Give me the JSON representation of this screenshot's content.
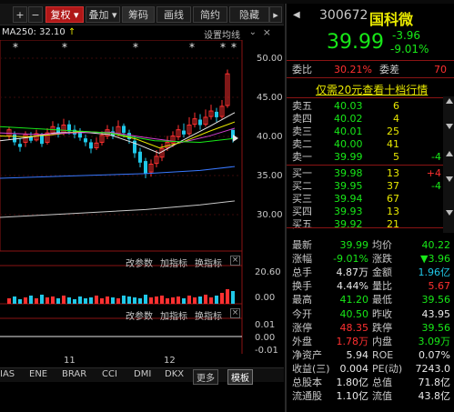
{
  "toolbar": {
    "plus_label": "+",
    "minus_label": "−",
    "rights_label": "复权",
    "overlay_label": "叠加",
    "chips_label": "筹码",
    "draw_label": "画线",
    "brief_label": "简约",
    "hide_label": "隐藏",
    "more_label": "▸"
  },
  "ma_bar": {
    "text": "MA250: 32.10",
    "settings": "设置均线"
  },
  "price_axis": [
    "50.00",
    "45.00",
    "40.00",
    "35.00",
    "30.00"
  ],
  "indicator1": {
    "params_label": "改参数",
    "add_label": "加指标",
    "switch_label": "换指标",
    "close_label": "×",
    "axis": [
      "20.60",
      "0.00"
    ]
  },
  "indicator2": {
    "params_label": "改参数",
    "add_label": "加指标",
    "switch_label": "换指标",
    "close_label": "×",
    "axis": [
      "0.01",
      "0.00",
      "-0.01"
    ]
  },
  "date_axis": [
    "11",
    "12"
  ],
  "bottom_tabs": [
    "IAS",
    "ENE",
    "BRAR",
    "CCI",
    "DMI",
    "DKX",
    "更多",
    "模板"
  ],
  "quote": {
    "code": "300672",
    "name": "国科微",
    "price": "39.99",
    "change": "-3.96",
    "change_pct": "-9.01%",
    "ratio_label": "委比",
    "ratio_value": "30.21%",
    "diff_label": "委差",
    "diff_value": "70",
    "promo": "仅需20元查看十档行情",
    "asks": [
      {
        "label": "卖五",
        "price": "40.03",
        "vol": "6",
        "delta": ""
      },
      {
        "label": "卖四",
        "price": "40.02",
        "vol": "4",
        "delta": ""
      },
      {
        "label": "卖三",
        "price": "40.01",
        "vol": "25",
        "delta": ""
      },
      {
        "label": "卖二",
        "price": "40.00",
        "vol": "41",
        "delta": ""
      },
      {
        "label": "卖一",
        "price": "39.99",
        "vol": "5",
        "delta": "-4"
      }
    ],
    "bids": [
      {
        "label": "买一",
        "price": "39.98",
        "vol": "13",
        "delta": "+4"
      },
      {
        "label": "买二",
        "price": "39.95",
        "vol": "37",
        "delta": "-4"
      },
      {
        "label": "买三",
        "price": "39.94",
        "vol": "67",
        "delta": ""
      },
      {
        "label": "买四",
        "price": "39.93",
        "vol": "13",
        "delta": ""
      },
      {
        "label": "买五",
        "price": "39.92",
        "vol": "21",
        "delta": ""
      }
    ],
    "stats": [
      {
        "l1": "最新",
        "v1": "39.99",
        "c1": "green",
        "l2": "均价",
        "v2": "40.22",
        "c2": "green"
      },
      {
        "l1": "涨幅",
        "v1": "-9.01%",
        "c1": "green",
        "l2": "涨跌",
        "v2": "▼3.96",
        "c2": "green"
      },
      {
        "l1": "总手",
        "v1": "4.87万",
        "c1": "white",
        "l2": "金额",
        "v2": "1.96亿",
        "c2": "cyan"
      },
      {
        "l1": "换手",
        "v1": "4.44%",
        "c1": "white",
        "l2": "量比",
        "v2": "5.67",
        "c2": "red"
      },
      {
        "l1": "最高",
        "v1": "41.20",
        "c1": "green",
        "l2": "最低",
        "v2": "39.56",
        "c2": "green"
      },
      {
        "l1": "今开",
        "v1": "40.50",
        "c1": "green",
        "l2": "昨收",
        "v2": "43.95",
        "c2": "white"
      },
      {
        "l1": "涨停",
        "v1": "48.35",
        "c1": "red",
        "l2": "跌停",
        "v2": "39.56",
        "c2": "green"
      },
      {
        "l1": "外盘",
        "v1": "1.78万",
        "c1": "red",
        "l2": "内盘",
        "v2": "3.09万",
        "c2": "green"
      },
      {
        "l1": "净资产",
        "v1": "5.94",
        "c1": "white",
        "l2": "ROE",
        "v2": "0.07%",
        "c2": "white"
      },
      {
        "l1": "收益(三)",
        "v1": "0.004",
        "c1": "white",
        "l2": "PE(动)",
        "v2": "7243.0",
        "c2": "white"
      },
      {
        "l1": "总股本",
        "v1": "1.80亿",
        "c1": "white",
        "l2": "总值",
        "v2": "71.8亿",
        "c2": "white"
      },
      {
        "l1": "流通股",
        "v1": "1.10亿",
        "c1": "white",
        "l2": "流值",
        "v2": "43.8亿",
        "c2": "white"
      }
    ]
  },
  "colors": {
    "up": "#ff3030",
    "down": "#18e818",
    "accent": "#e8e800",
    "background": "#000000"
  }
}
